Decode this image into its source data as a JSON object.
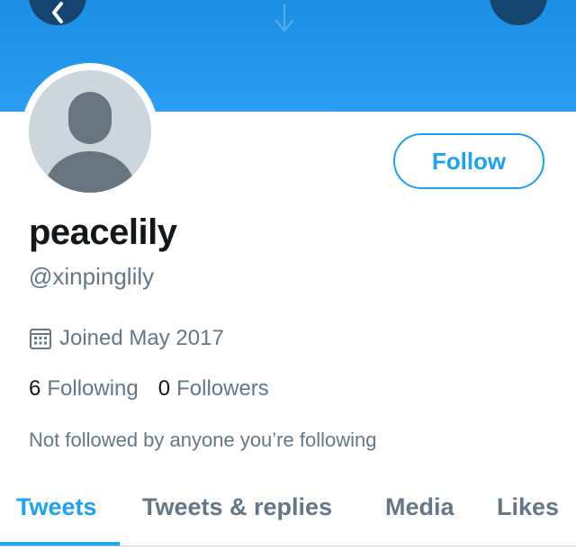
{
  "header": {
    "back_icon": "chevron-left-icon",
    "more_icon": "more-icon",
    "banner_color": "#1da1f2"
  },
  "profile": {
    "avatar_icon": "default-avatar-icon",
    "display_name": "peacelily",
    "handle": "@xinpinglily",
    "joined_icon": "calendar-icon",
    "joined": "Joined May 2017",
    "following_count": "6",
    "following_label": "Following",
    "followers_count": "0",
    "followers_label": "Followers",
    "not_followed_text": "Not followed by anyone you’re following"
  },
  "actions": {
    "follow_label": "Follow"
  },
  "tabs": [
    {
      "label": "Tweets",
      "active": true
    },
    {
      "label": "Tweets & replies",
      "active": false
    },
    {
      "label": "Media",
      "active": false
    },
    {
      "label": "Likes",
      "active": false
    }
  ],
  "colors": {
    "accent": "#1da1f2",
    "text_primary": "#14171a",
    "text_secondary": "#657786",
    "avatar_bg": "#ccd6dd"
  }
}
